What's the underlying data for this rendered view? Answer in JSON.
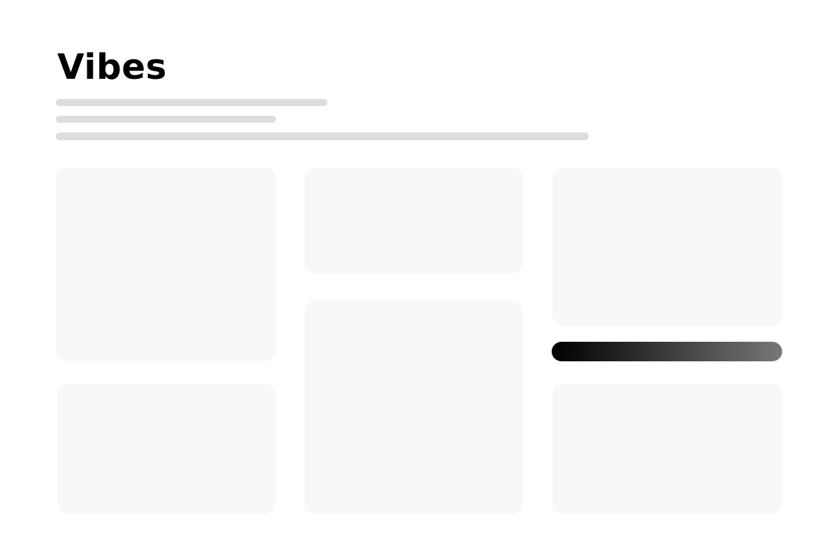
{
  "header": {
    "title": "Vibes"
  },
  "colors": {
    "title": "#000000",
    "skeleton_line": "#dddddd",
    "card": "#f8f8f8",
    "gradient_start": "#000000",
    "gradient_end": "#777777"
  }
}
